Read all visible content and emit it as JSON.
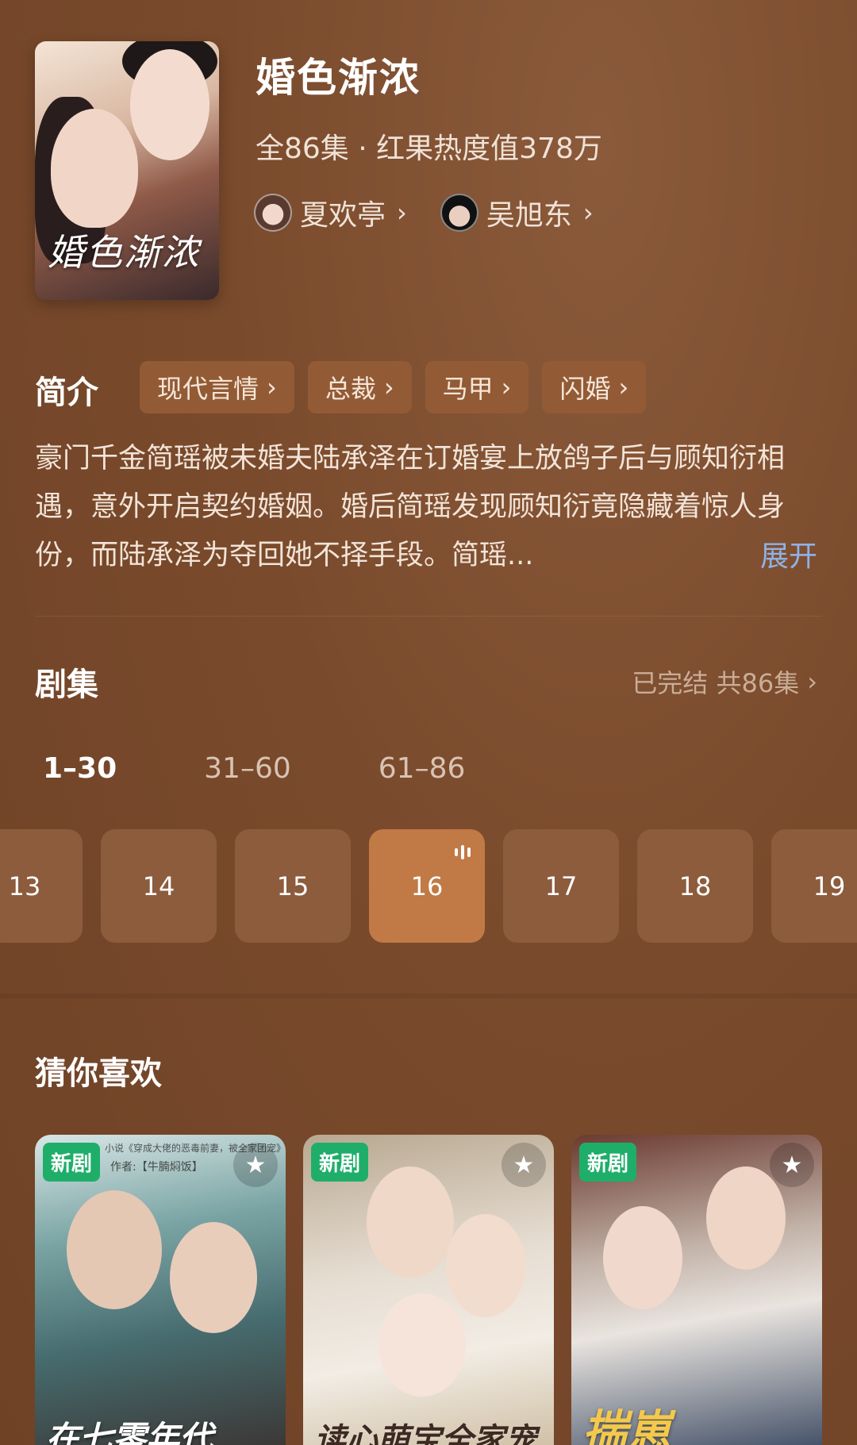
{
  "drama": {
    "title": "婚色渐浓",
    "poster_title": "婚色渐浓",
    "meta": "全86集 · 红果热度值378万",
    "actors": [
      {
        "name": "夏欢亭",
        "chevron": "›"
      },
      {
        "name": "吴旭东",
        "chevron": "›"
      }
    ]
  },
  "intro": {
    "label": "简介",
    "tags": [
      {
        "label": "现代言情",
        "chevron": "›"
      },
      {
        "label": "总裁",
        "chevron": "›"
      },
      {
        "label": "马甲",
        "chevron": "›"
      },
      {
        "label": "闪婚",
        "chevron": "›"
      }
    ],
    "description": "豪门千金简瑶被未婚夫陆承泽在订婚宴上放鸽子后与顾知衍相遇，意外开启契约婚姻。婚后简瑶发现顾知衍竟隐藏着惊人身份，而陆承泽为夺回她不择手段。简瑶...",
    "expand": "展开"
  },
  "episodes": {
    "label": "剧集",
    "status": "已完结 共86集",
    "status_chevron": "›",
    "ranges": [
      "1–30",
      "31–60",
      "61–86"
    ],
    "active_range": 0,
    "items": [
      "13",
      "14",
      "15",
      "16",
      "17",
      "18",
      "19"
    ],
    "current": "16"
  },
  "recommend": {
    "label": "猜你喜欢",
    "cards": [
      {
        "badge": "新剧",
        "title": "在七零年代",
        "top_text": "小说《穿成大佬的恶毒前妻，被全家团宠》",
        "author": "作者:【牛腩焖饭】"
      },
      {
        "badge": "新剧",
        "title": "读心萌宝全家宠"
      },
      {
        "badge": "新剧",
        "title": "揣崽"
      }
    ]
  },
  "colors": {
    "background": "#77482a",
    "tag_bg": "#925b36",
    "episode_bg": "#8c5c3d",
    "episode_active": "#c17a45",
    "badge_green": "#1fae6a",
    "link_blue": "#8fb2e6"
  }
}
